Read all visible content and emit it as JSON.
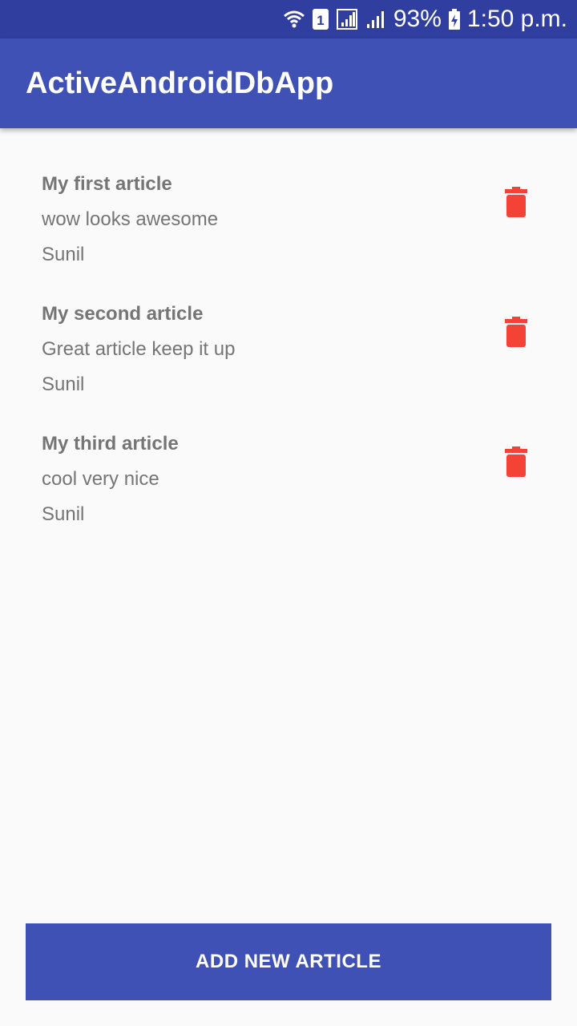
{
  "status_bar": {
    "background": "#303F9F",
    "icons": [
      "wifi-icon",
      "sim-1-icon",
      "signal-icon",
      "signal-icon",
      "battery-charging-icon"
    ],
    "sim_label": "1",
    "battery": "93%",
    "time": "1:50 p.m."
  },
  "app_bar": {
    "title": "ActiveAndroidDbApp",
    "background": "#3F51B5"
  },
  "articles": [
    {
      "title": "My first article",
      "body": "wow looks awesome",
      "author": "Sunil",
      "delete_icon": "trash-icon"
    },
    {
      "title": "My second article",
      "body": "Great article keep it up",
      "author": "Sunil",
      "delete_icon": "trash-icon"
    },
    {
      "title": "My third article",
      "body": "cool very nice",
      "author": "Sunil",
      "delete_icon": "trash-icon"
    }
  ],
  "add_button": {
    "label": "ADD NEW ARTICLE",
    "background": "#3F51B5"
  },
  "colors": {
    "primary": "#3F51B5",
    "primary_dark": "#303F9F",
    "delete": "#F44336",
    "text_secondary": "#757575",
    "background": "#FAFAFA"
  }
}
